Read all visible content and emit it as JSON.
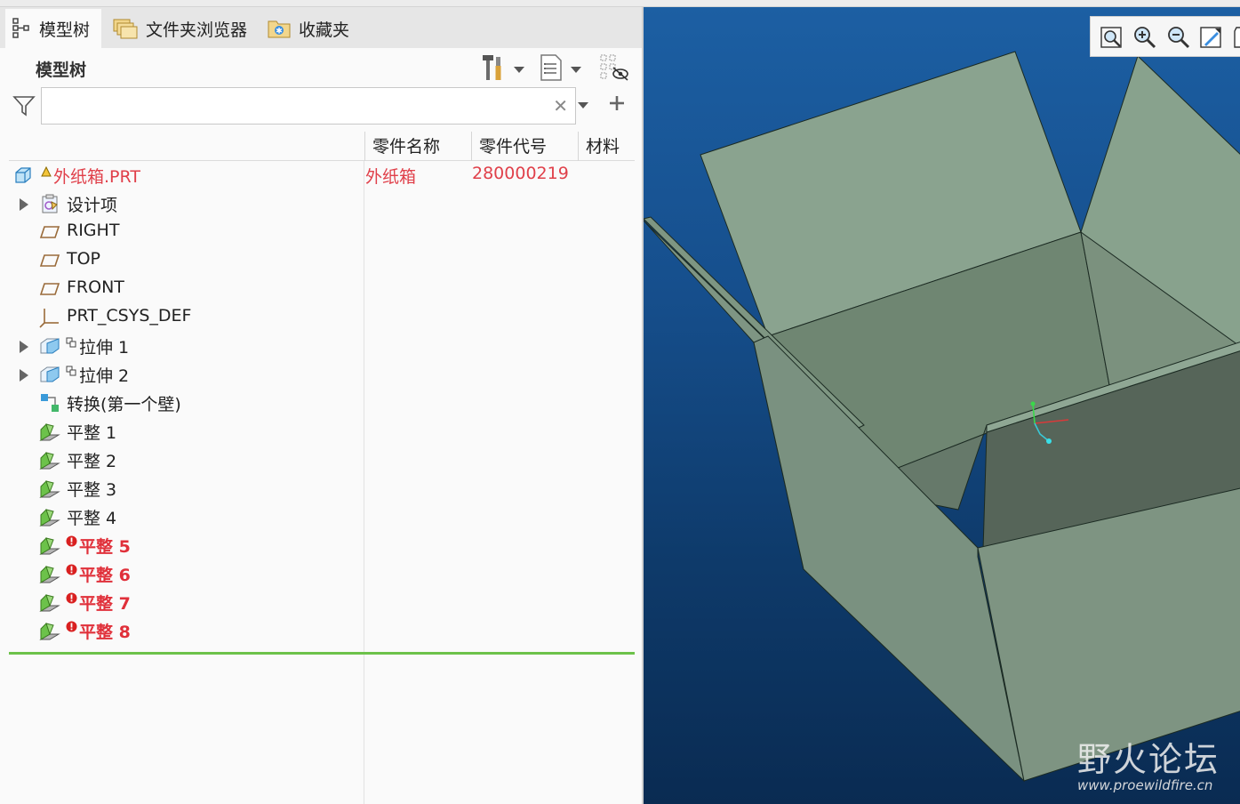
{
  "tabs": [
    {
      "label": "模型树",
      "icon": "model-tree-icon"
    },
    {
      "label": "文件夹浏览器",
      "icon": "folder-browser-icon"
    },
    {
      "label": "收藏夹",
      "icon": "favorites-icon"
    }
  ],
  "panel": {
    "title": "模型树",
    "search_value": "",
    "search_placeholder": ""
  },
  "columns": [
    "零件名称",
    "零件代号",
    "材料"
  ],
  "tree": [
    {
      "label": "外纸箱.PRT",
      "icon": "part-icon",
      "style": "root",
      "badge": "warning-badge",
      "part_name": "外纸箱",
      "part_code": "280000219"
    },
    {
      "label": "设计项",
      "icon": "design-items-icon",
      "expandable": true
    },
    {
      "label": "RIGHT",
      "icon": "datum-plane-icon"
    },
    {
      "label": "TOP",
      "icon": "datum-plane-icon"
    },
    {
      "label": "FRONT",
      "icon": "datum-plane-icon"
    },
    {
      "label": "PRT_CSYS_DEF",
      "icon": "coordinate-system-icon"
    },
    {
      "label": "拉伸 1",
      "icon": "extrude-icon",
      "expandable": true,
      "badge": "link-badge"
    },
    {
      "label": "拉伸 2",
      "icon": "extrude-icon",
      "expandable": true,
      "badge": "link-badge"
    },
    {
      "label": "转换(第一个壁)",
      "icon": "convert-icon"
    },
    {
      "label": "平整 1",
      "icon": "flat-wall-icon"
    },
    {
      "label": "平整 2",
      "icon": "flat-wall-icon"
    },
    {
      "label": "平整 3",
      "icon": "flat-wall-icon"
    },
    {
      "label": "平整 4",
      "icon": "flat-wall-icon"
    },
    {
      "label": "平整 5",
      "icon": "flat-wall-icon",
      "style": "err",
      "badge": "error-badge"
    },
    {
      "label": "平整 6",
      "icon": "flat-wall-icon",
      "style": "err",
      "badge": "error-badge"
    },
    {
      "label": "平整 7",
      "icon": "flat-wall-icon",
      "style": "err",
      "badge": "error-badge"
    },
    {
      "label": "平整 8",
      "icon": "flat-wall-icon",
      "style": "err",
      "badge": "error-badge"
    }
  ],
  "viewport": {
    "toolbar": [
      "refit-icon",
      "zoom-in-icon",
      "zoom-out-icon",
      "repaint-icon"
    ],
    "colors": {
      "background_top": "#1c5fa3",
      "background_bottom": "#0a2b52",
      "model": "#7f9584"
    }
  },
  "watermark": {
    "text": "野火论坛",
    "url": "www.proewildfire.cn"
  }
}
